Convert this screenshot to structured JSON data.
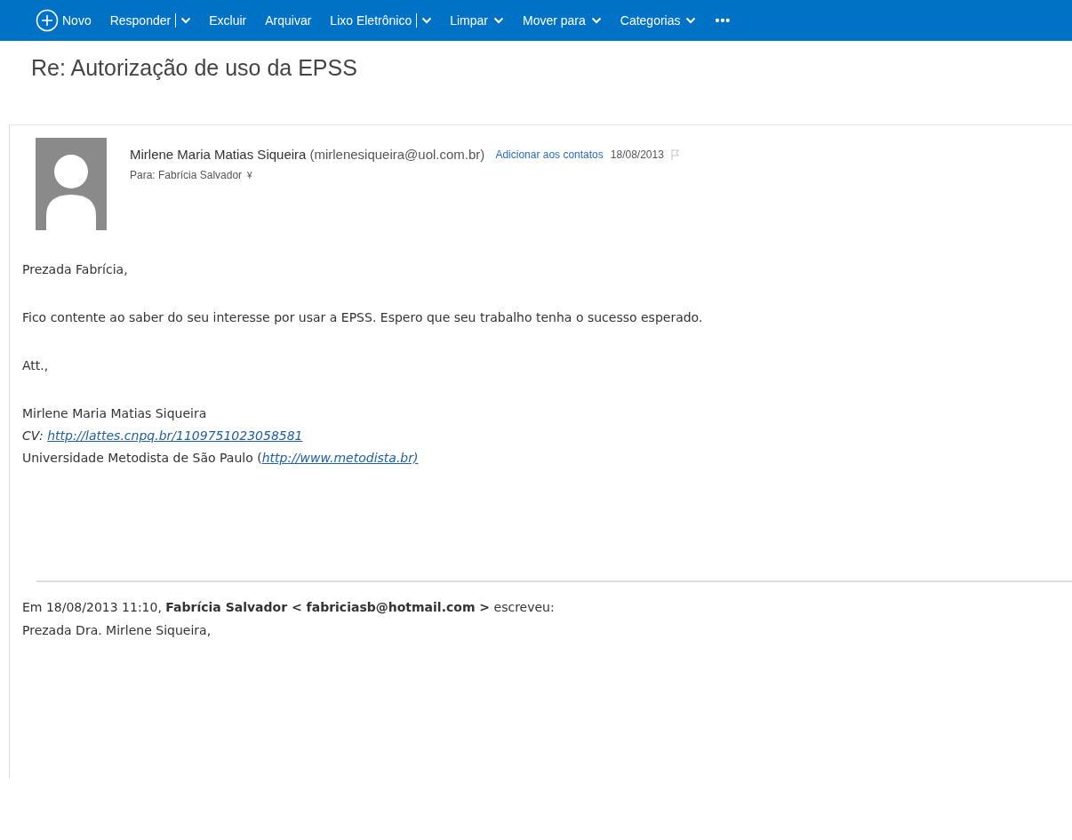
{
  "toolbar": [
    {
      "kind": "new",
      "label": "Novo"
    },
    {
      "kind": "split",
      "label": "Responder"
    },
    {
      "kind": "plain",
      "label": "Excluir"
    },
    {
      "kind": "plain",
      "label": "Arquivar"
    },
    {
      "kind": "split",
      "label": "Lixo Eletrônico"
    },
    {
      "kind": "dropdown",
      "label": "Limpar"
    },
    {
      "kind": "dropdown",
      "label": "Mover para"
    },
    {
      "kind": "dropdown",
      "label": "Categorias"
    },
    {
      "kind": "more",
      "label": "•••"
    }
  ],
  "subject": "Re: Autorização de uso da EPSS",
  "message": {
    "sender": "Mirlene Maria Matias Siqueira",
    "sender_email": "(mirlenesiqueira@uol.com.br)",
    "add_contact": "Adicionar aos contatos",
    "date": "18/08/2013",
    "to": "Para: Fabrícia Salvador",
    "to_toggle": "¥"
  },
  "body": {
    "paragraphs": [
      "Prezada Fabrícia,",
      "Fico contente ao saber do seu interesse por usar a EPSS. Espero que seu trabalho tenha o sucesso esperado.",
      "Att.,"
    ],
    "signature": [
      {
        "kind": "text",
        "text": "Mirlene Maria Matias Siqueira"
      },
      {
        "kind": "cv",
        "text": "CV: ",
        "link": "http://lattes.cnpq.br/1109751023058581"
      },
      {
        "kind": "org",
        "text": "Universidade Metodista de São Paulo (",
        "link": "http://www.metodista.br)"
      }
    ]
  },
  "quote": {
    "header": "Em 18/08/2013 11:10, **Fabrícia Salvador < fabriciasb@hotmail.com >** escreveu:",
    "greeting": "Prezada Dra. Mirlene Siqueira,"
  }
}
